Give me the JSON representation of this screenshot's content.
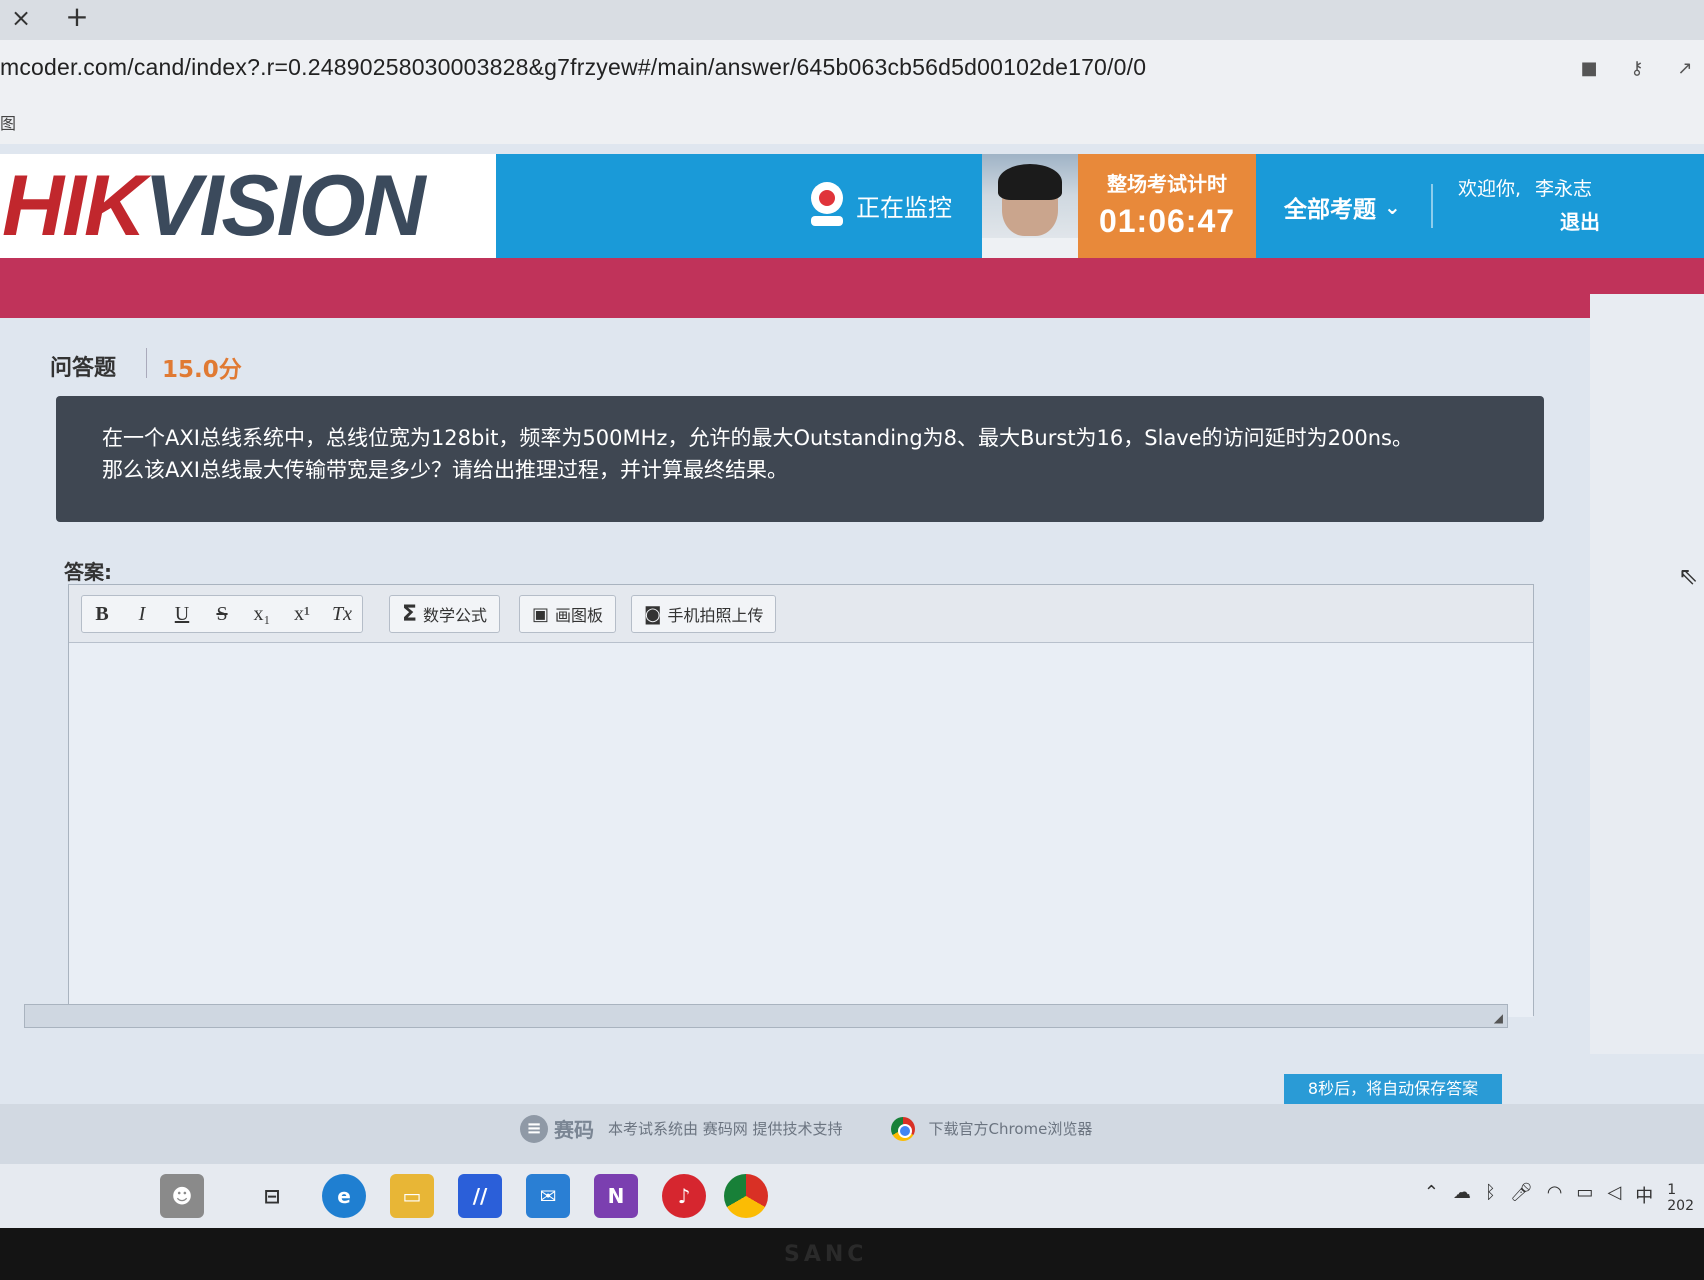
{
  "browser": {
    "tab_close": "×",
    "tab_new": "+",
    "url": "mcoder.com/cand/index?.r=0.24890258030003828&g7frzyew#/main/answer/645b063cb56d5d00102de170/0/0",
    "bookmark_item": "图"
  },
  "header": {
    "logo_hik": "HIK",
    "logo_vision": "VISION",
    "monitor_label": "正在监控",
    "timer_label": "整场考试计时",
    "timer_value": "01:06:47",
    "all_questions_label": "全部考题",
    "welcome_label": "欢迎你,",
    "user_name": "李永志",
    "logout_label": "退出"
  },
  "question": {
    "type": "问答题",
    "score": "15.0分",
    "text_line1": "在一个AXI总线系统中，总线位宽为128bit，频率为500MHz，允许的最大Outstanding为8、最大Burst为16，Slave的访问延时为200ns。",
    "text_line2": "那么该AXI总线最大传输带宽是多少？请给出推理过程，并计算最终结果。"
  },
  "answer": {
    "label": "答案:",
    "toolbar": {
      "bold": "B",
      "italic": "I",
      "underline": "U",
      "strike": "S",
      "subscript": "x₁",
      "superscript": "x¹",
      "clear_format": "Tx",
      "math_formula": "数学公式",
      "drawing_board": "画图板",
      "phone_upload": "手机拍照上传"
    },
    "autosave_text": "8秒后，将自动保存答案"
  },
  "footer": {
    "brand": "赛码",
    "support_text": "本考试系统由 赛码网 提供技术支持",
    "chrome_text": "下载官方Chrome浏览器"
  },
  "monitor_brand": "SANC",
  "tray": {
    "ime": "中",
    "time_partial": "1",
    "date_partial": "202"
  }
}
